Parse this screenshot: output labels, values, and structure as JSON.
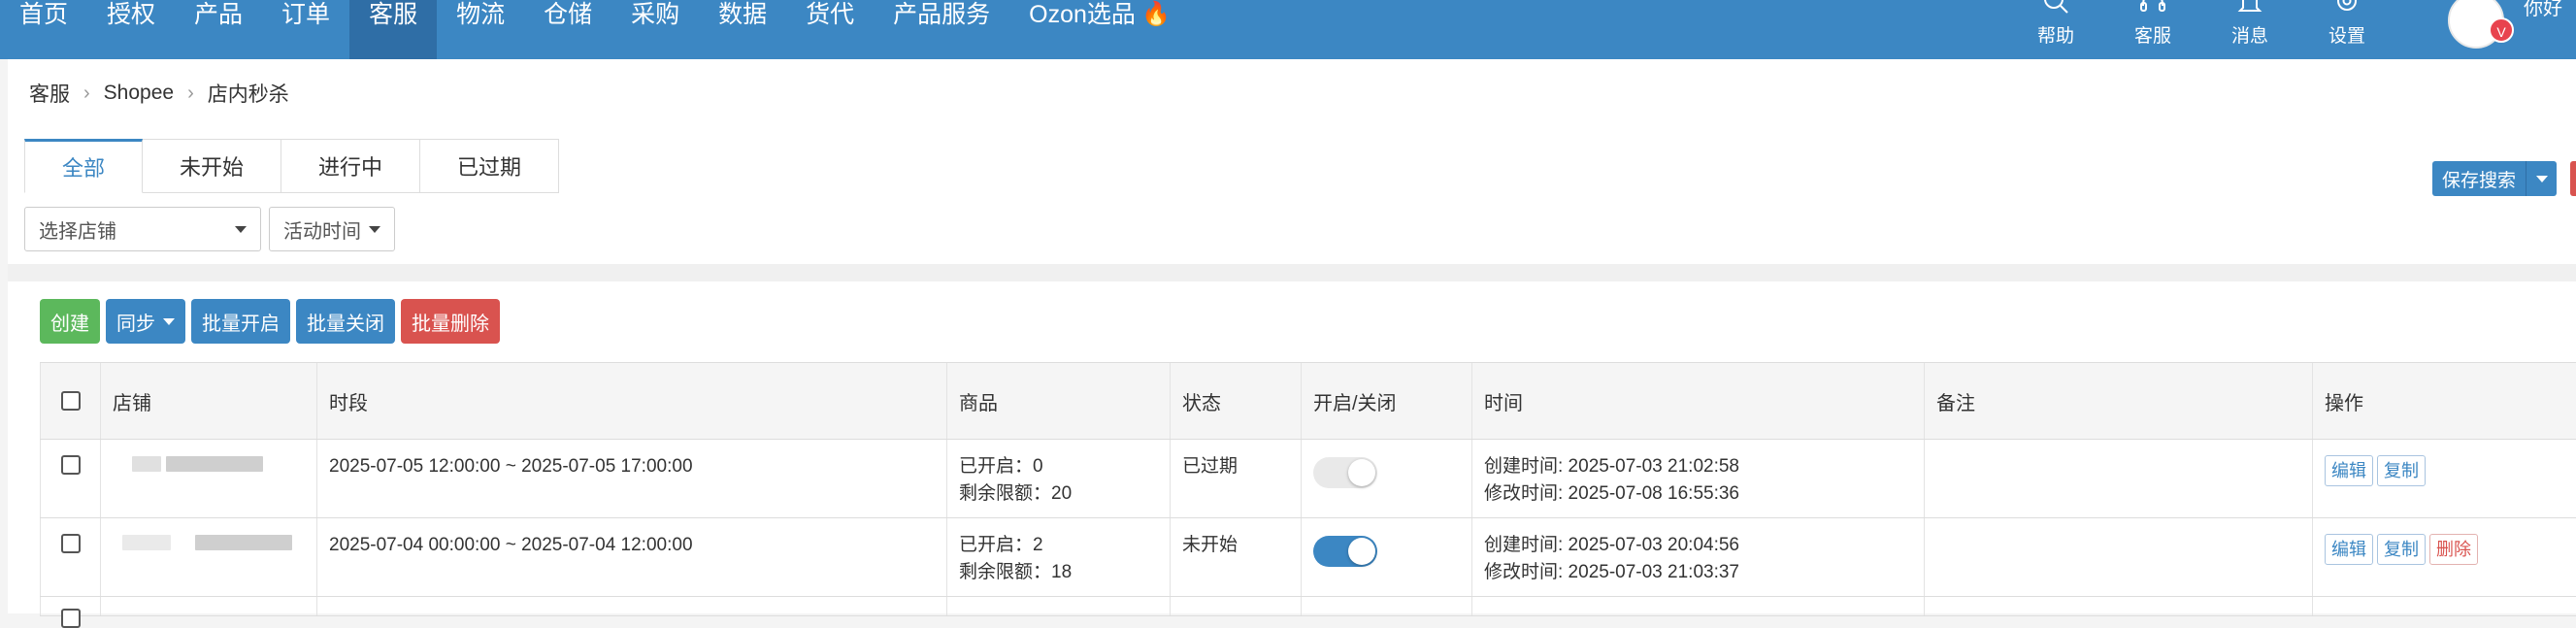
{
  "nav": {
    "items": [
      "首页",
      "授权",
      "产品",
      "订单",
      "客服",
      "物流",
      "仓储",
      "采购",
      "数据",
      "货代",
      "产品服务",
      "Ozon选品"
    ],
    "active_index": 4,
    "right_icons": [
      {
        "label": "帮助",
        "icon": "search-icon"
      },
      {
        "label": "客服",
        "icon": "headset-icon"
      },
      {
        "label": "消息",
        "icon": "bell-icon"
      },
      {
        "label": "设置",
        "icon": "gear-icon"
      }
    ],
    "greeting": "你好",
    "badge": "V"
  },
  "breadcrumb": [
    "客服",
    "Shopee",
    "店内秒杀"
  ],
  "tabs": [
    "全部",
    "未开始",
    "进行中",
    "已过期"
  ],
  "filters": {
    "shop_placeholder": "选择店铺",
    "activity_time": "活动时间"
  },
  "save_search": "保存搜索",
  "actions": {
    "create": "创建",
    "sync": "同步",
    "batch_enable": "批量开启",
    "batch_disable": "批量关闭",
    "batch_delete": "批量删除"
  },
  "table": {
    "headers": [
      "店铺",
      "时段",
      "商品",
      "状态",
      "开启/关闭",
      "时间",
      "备注",
      "操作"
    ],
    "rows": [
      {
        "period": "2025-07-05 12:00:00 ~ 2025-07-05 17:00:00",
        "goods_enabled": "已开启：0",
        "goods_remaining": "剩余限额：20",
        "status": "已过期",
        "enabled": false,
        "created": "创建时间: 2025-07-03 21:02:58",
        "modified": "修改时间: 2025-07-08 16:55:36",
        "note": "",
        "ops": [
          "编辑",
          "复制"
        ]
      },
      {
        "period": "2025-07-04 00:00:00 ~ 2025-07-04 12:00:00",
        "goods_enabled": "已开启：2",
        "goods_remaining": "剩余限额：18",
        "status": "未开始",
        "enabled": true,
        "created": "创建时间: 2025-07-03 20:04:56",
        "modified": "修改时间: 2025-07-03 21:03:37",
        "note": "",
        "ops": [
          "编辑",
          "复制",
          "删除"
        ]
      }
    ]
  }
}
